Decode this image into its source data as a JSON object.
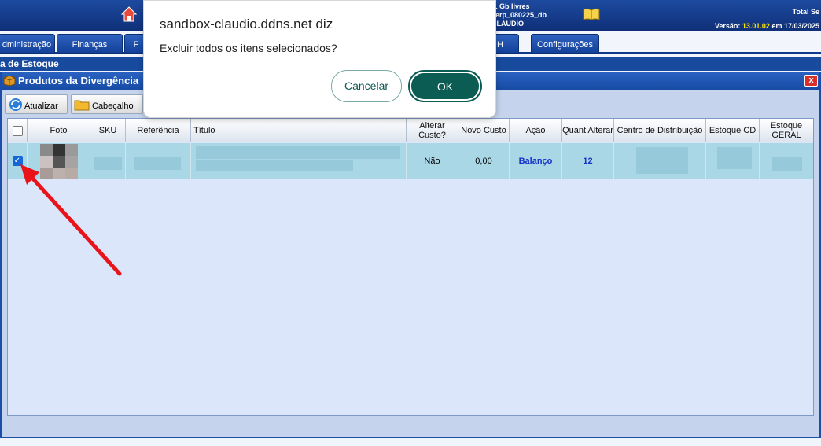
{
  "header": {
    "server_lines": [
      ".1 Gb livres",
      "_erp_080225_db",
      "CLAUDIO"
    ],
    "total_label": "Total Se",
    "version_prefix": "Versão:",
    "version_number": "13.01.02",
    "version_suffix": "em 17/03/2025"
  },
  "nav": {
    "tabs": [
      "dministração",
      "Finanças",
      "F",
      "H",
      "Configurações"
    ]
  },
  "page_title": "a de Estoque",
  "window": {
    "title": "Produtos da Divergência",
    "close_label": "x"
  },
  "toolbar": {
    "refresh_label": "Atualizar",
    "header_label": "Cabeçalho"
  },
  "table": {
    "columns": {
      "foto": "Foto",
      "sku": "SKU",
      "referencia": "Referência",
      "titulo": "Título",
      "alterar_custo": "Alterar Custo?",
      "novo_custo": "Novo Custo",
      "acao": "Ação",
      "quant_alterar": "Quant Alterar",
      "centro": "Centro de Distribuição",
      "estoque_cd": "Estoque CD",
      "estoque_geral": "Estoque GERAL"
    },
    "rows": [
      {
        "checked": true,
        "alterar_custo": "Não",
        "novo_custo": "0,00",
        "acao": "Balanço",
        "quant_alterar": "12"
      }
    ]
  },
  "dialog": {
    "origin": "sandbox-claudio.ddns.net diz",
    "message": "Excluir todos os itens selecionados?",
    "cancel_label": "Cancelar",
    "ok_label": "OK"
  },
  "colors": {
    "accent_blue": "#184a9e",
    "row_highlight": "#a9d7e6",
    "dialog_ok": "#0b5c52",
    "arrow": "#e8141a",
    "action_text": "#1533c8"
  }
}
